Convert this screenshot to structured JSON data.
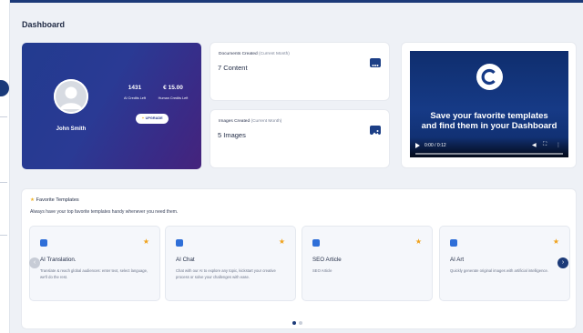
{
  "page": {
    "title": "Dashboard"
  },
  "profile": {
    "name": "John Smith",
    "ai_credits_value": "1431",
    "ai_credits_label": "AI Credits Left",
    "human_credits_value": "€ 15.00",
    "human_credits_label": "Human Credits Left",
    "upgrade_label": "UPGRADE"
  },
  "documents": {
    "title": "Documents Created",
    "period": "(Current Month)",
    "value": "7 Content",
    "icon": "folder-icon"
  },
  "images": {
    "title": "Images Created",
    "period": "(Current Month)",
    "value": "5 Images",
    "icon": "image-icon"
  },
  "video": {
    "logo_letter": "C",
    "headline_line1": "Save your favorite templates",
    "headline_line2": "and find them in your Dashboard",
    "time": "0:00 / 0:12",
    "progress": 0.0
  },
  "favorites": {
    "title": "Favorite Templates",
    "subtitle": "Always have your top favorite templates handy whenever you need them.",
    "cards": [
      {
        "name": "AI Translation.",
        "description": "Translate & reach global audiences: enter text, select language, we'll do the rest."
      },
      {
        "name": "AI Chat",
        "description": "Chat with our AI to explore any topic, kickstart your creative process or solve your challenges with ease."
      },
      {
        "name": "SEO Article",
        "description": "SEO Article"
      },
      {
        "name": "AI Art",
        "description": "Quickly generate original images with artificial intelligence."
      }
    ],
    "prev_arrow": "‹",
    "next_arrow": "›"
  },
  "colors": {
    "primary": "#1c3a78",
    "profile_gradient_start": "#223b8f",
    "profile_gradient_end": "#45237c",
    "star": "#f0b429"
  }
}
